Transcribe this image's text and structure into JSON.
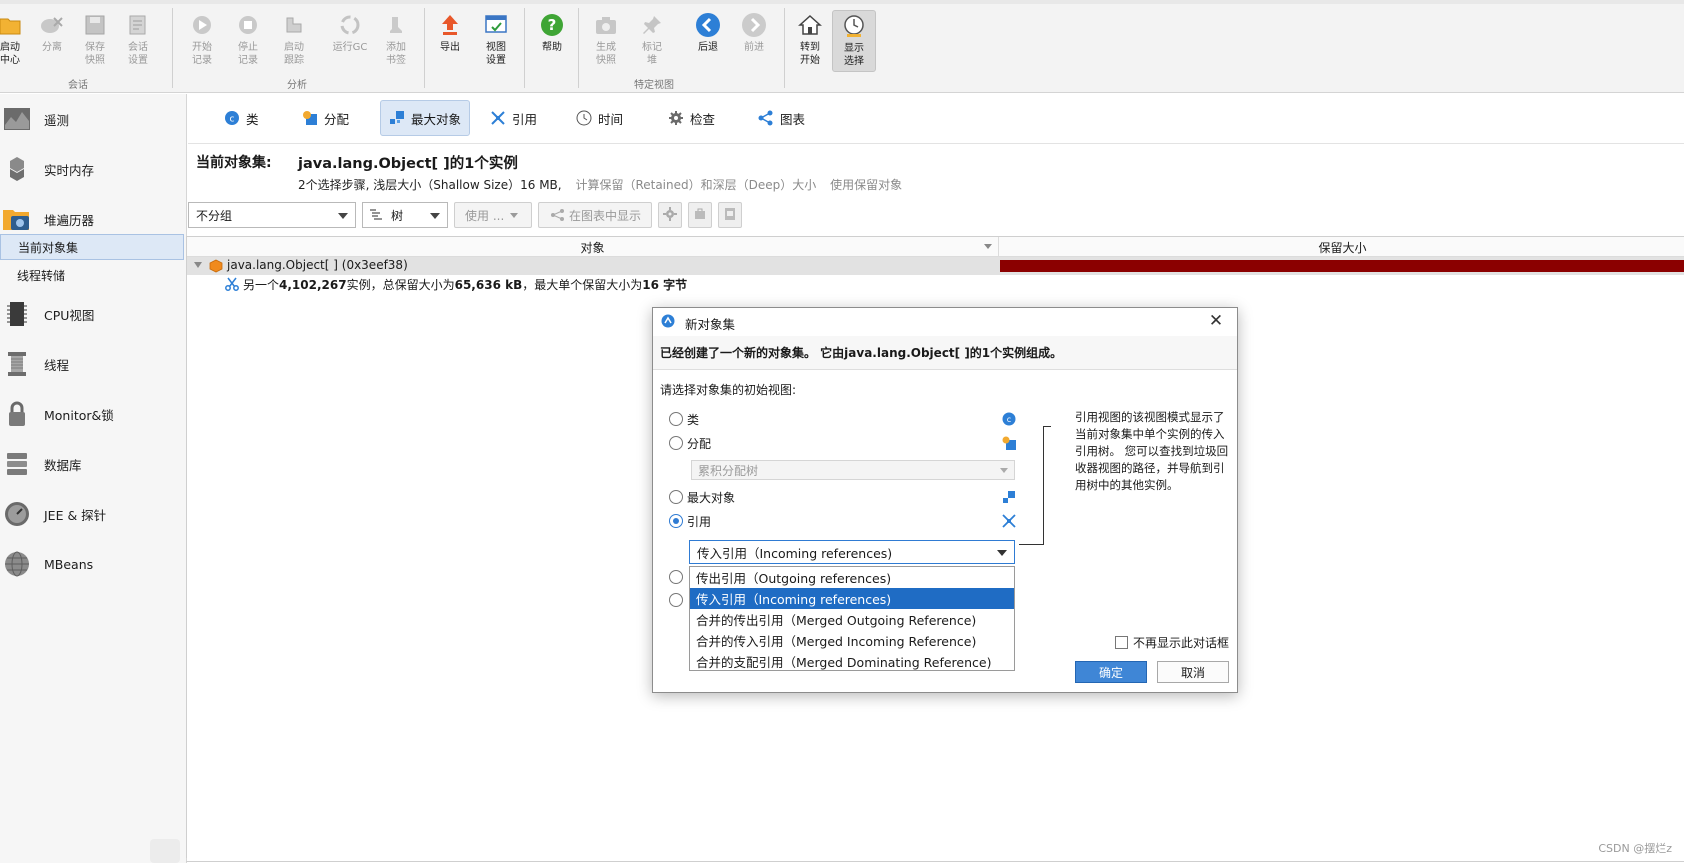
{
  "toolbar": {
    "buttons": [
      {
        "label": "启动\n中心"
      },
      {
        "label": "分离"
      },
      {
        "label": "保存\n快照"
      },
      {
        "label": "会话\n设置"
      },
      {
        "label": "开始\n记录"
      },
      {
        "label": "停止\n记录"
      },
      {
        "label": "启动\n跟踪"
      },
      {
        "label": "运行GC"
      },
      {
        "label": "添加\n书签"
      },
      {
        "label": "导出"
      },
      {
        "label": "视图\n设置"
      },
      {
        "label": "帮助"
      },
      {
        "label": "生成\n快照"
      },
      {
        "label": "标记\n堆"
      },
      {
        "label": "后退"
      },
      {
        "label": "前进"
      },
      {
        "label": "转到\n开始"
      },
      {
        "label": "显示\n选择"
      }
    ],
    "groups": {
      "session": "会话",
      "analysis": "分析",
      "view_specific": "特定视图"
    }
  },
  "sidebar": {
    "items": [
      {
        "label": "遥测"
      },
      {
        "label": "实时内存"
      },
      {
        "label": "堆遍历器"
      },
      {
        "label": "CPU视图"
      },
      {
        "label": "线程"
      },
      {
        "label": "Monitor&锁"
      },
      {
        "label": "数据库"
      },
      {
        "label": "JEE & 探针"
      },
      {
        "label": "MBeans"
      }
    ],
    "subitems": [
      {
        "label": "当前对象集"
      },
      {
        "label": "线程转储"
      }
    ]
  },
  "view_tabs": [
    {
      "label": "类"
    },
    {
      "label": "分配"
    },
    {
      "label": "最大对象"
    },
    {
      "label": "引用"
    },
    {
      "label": "时间"
    },
    {
      "label": "检查"
    },
    {
      "label": "图表"
    }
  ],
  "object_set": {
    "title": "当前对象集:",
    "description": "java.lang.Object[ ]的1个实例",
    "summary": "2个选择步骤, 浅层大小（Shallow Size）16 MB,",
    "link_retained": "计算保留（Retained）和深层（Deep）大小",
    "link_use_retained": "使用保留对象"
  },
  "filters": {
    "grouping": "不分组",
    "mode": "树",
    "use_button": "使用 ...",
    "show_in_graph": "在图表中显示"
  },
  "grid": {
    "columns": {
      "object": "对象",
      "retained": "保留大小"
    },
    "row1": "java.lang.Object[ ] (0x3eef38)",
    "row2_prefix": "另一个",
    "row2_count": "4,102,267",
    "row2_mid": "实例，总保留大小为",
    "row2_total": "65,636 kB",
    "row2_mid2": "，最大单个保留大小为",
    "row2_max": "16 字节",
    "retained_fraction": 1.0
  },
  "dialog": {
    "title": "新对象集",
    "header": "已经创建了一个新的对象集。 它由java.lang.Object[ ]的1个实例组成。",
    "prompt": "请选择对象集的初始视图:",
    "options": [
      {
        "label": "类",
        "selected": false
      },
      {
        "label": "分配",
        "selected": false
      },
      {
        "label": "最大对象",
        "selected": false
      },
      {
        "label": "引用",
        "selected": true
      }
    ],
    "alloc_combo": "累积分配树",
    "ref_combo": "传入引用（Incoming references)",
    "dropdown": [
      {
        "label": "传出引用（Outgoing references)",
        "selected": false
      },
      {
        "label": "传入引用（Incoming references)",
        "selected": true
      },
      {
        "label": "合并的传出引用（Merged Outgoing Reference)",
        "selected": false
      },
      {
        "label": "合并的传入引用（Merged Incoming Reference)",
        "selected": false
      },
      {
        "label": "合并的支配引用（Merged Dominating Reference)",
        "selected": false
      }
    ],
    "callout": "引用视图的该视图模式显示了当前对象集中单个实例的传入引用树。 您可以查找到垃圾回收器视图的路径，并导航到引用树中的其他实例。",
    "dont_show": "不再显示此对话框",
    "ok": "确定",
    "cancel": "取消"
  },
  "watermark": "CSDN @摆烂z",
  "colors": {
    "accent": "#1f6cc4",
    "retained_bar": "#8b0000",
    "selection": "#dde8f6"
  }
}
